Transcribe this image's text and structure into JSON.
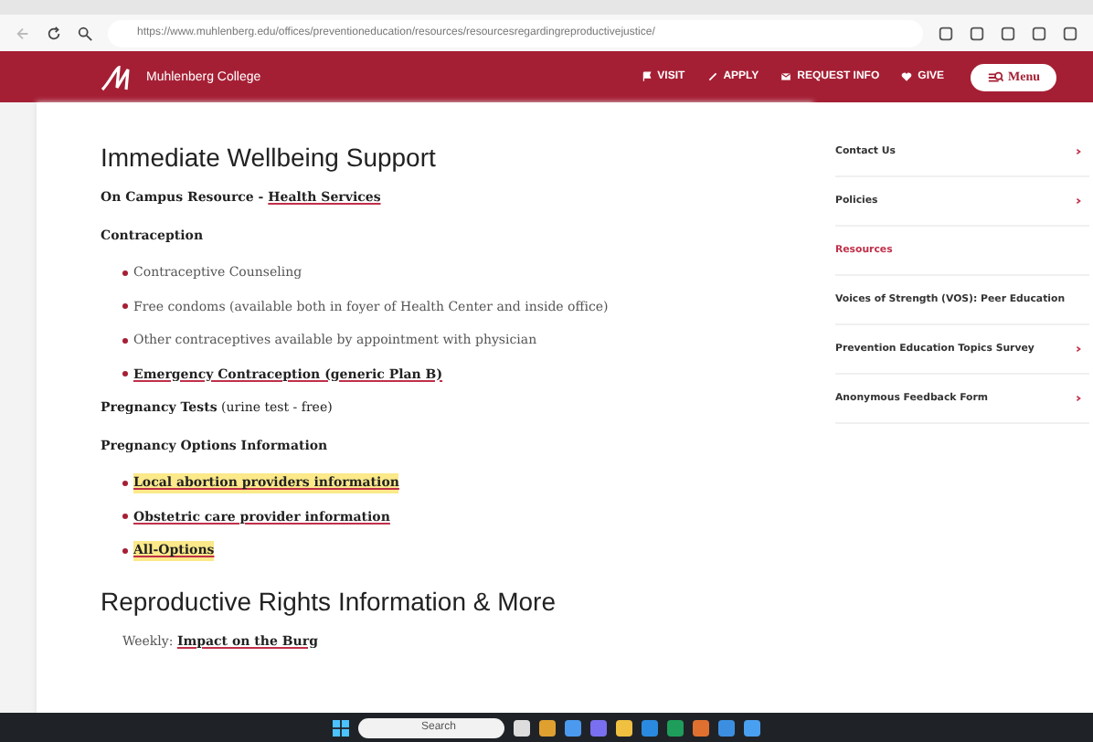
{
  "browser": {
    "url": "https://www.muhlenberg.edu/offices/preventioneducation/resources/resourcesregardingreproductivejustice/"
  },
  "header": {
    "logo_text": "Muhlenberg College",
    "nav": [
      {
        "label": "VISIT"
      },
      {
        "label": "APPLY"
      },
      {
        "label": "REQUEST INFO"
      },
      {
        "label": "GIVE"
      }
    ],
    "menu_button": "Menu"
  },
  "sections": [
    {
      "heading": "Immediate Wellbeing Support",
      "blocks": [
        {
          "kind": "para",
          "bold": "On Campus Resource - ",
          "link": "Health Services"
        },
        {
          "kind": "para",
          "bold": "Contraception"
        },
        {
          "kind": "list",
          "items": [
            {
              "text": "Contraceptive Counseling",
              "link": false,
              "highlighted": false
            },
            {
              "text": "Free condoms (available both in foyer of Health Center and inside office)",
              "link": false,
              "highlighted": false
            },
            {
              "text": "Other contraceptives available by appointment with physician",
              "link": false,
              "highlighted": false
            },
            {
              "text": "Emergency Contraception (generic Plan B)",
              "link": true,
              "highlighted": false
            }
          ]
        },
        {
          "kind": "para",
          "bold": "Pregnancy Tests",
          "plain": " (urine test - free)"
        },
        {
          "kind": "para",
          "bold": "Pregnancy Options Information"
        },
        {
          "kind": "list",
          "items": [
            {
              "text": "Local abortion providers information",
              "link": true,
              "highlighted": true
            },
            {
              "text": "Obstetric care provider information",
              "link": true,
              "highlighted": false
            },
            {
              "text": "All-Options",
              "link": true,
              "highlighted": true
            }
          ]
        }
      ]
    },
    {
      "heading": "Reproductive Rights Information & More",
      "blocks": [
        {
          "kind": "indent",
          "plain": "Weekly: ",
          "link": "Impact on the Burg"
        }
      ]
    }
  ],
  "sidebar": [
    {
      "label": "Contact Us",
      "selected": false,
      "arrow": true
    },
    {
      "label": "Policies",
      "selected": false,
      "arrow": true
    },
    {
      "label": "Resources",
      "selected": true,
      "arrow": false
    },
    {
      "label": "Voices of Strength (VOS): Peer Education",
      "selected": false,
      "arrow": false
    },
    {
      "label": "Prevention Education Topics Survey",
      "selected": false,
      "arrow": true
    },
    {
      "label": "Anonymous Feedback Form",
      "selected": false,
      "arrow": true
    }
  ],
  "taskbar": {
    "search": "Search"
  }
}
